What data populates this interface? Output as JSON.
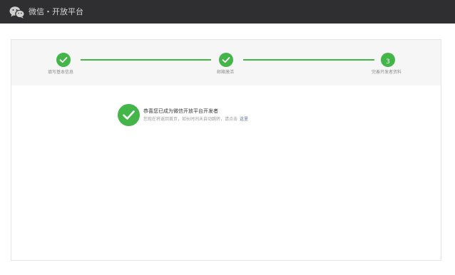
{
  "header": {
    "logo_icon": "wechat-logo-icon",
    "brand": "微信・开放平台"
  },
  "steps": [
    {
      "label": "填写基本信息",
      "state": "done",
      "icon": "check-icon"
    },
    {
      "label": "邮箱激活",
      "state": "done",
      "icon": "check-icon"
    },
    {
      "label": "完善开发者资料",
      "state": "current",
      "number": "3"
    }
  ],
  "result": {
    "icon": "success-check-icon",
    "title": "恭喜您已成为微信开放平台开发者",
    "desc": "您现在将返回首页，如长时间未自动跳转，请点击",
    "link": "这里"
  },
  "colors": {
    "topbar": "#2f2f31",
    "accent": "#44b549",
    "link": "#576b95"
  }
}
